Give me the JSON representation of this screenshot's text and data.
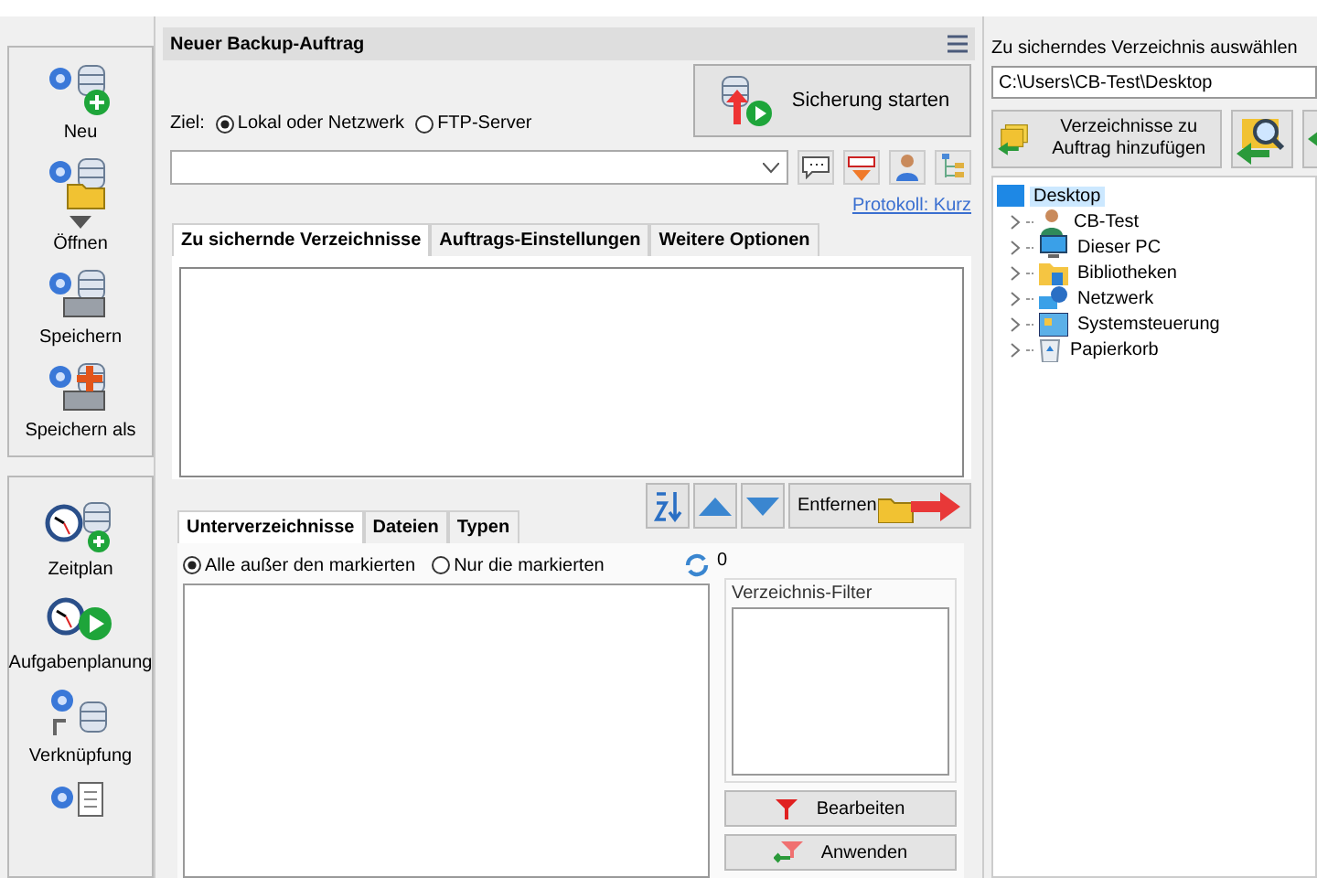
{
  "sidebar": {
    "groups": [
      {
        "items": [
          {
            "label": "Neu",
            "kind": "new"
          },
          {
            "label": "Öffnen",
            "kind": "open"
          },
          {
            "label": "Speichern",
            "kind": "save"
          },
          {
            "label": "Speichern als",
            "kind": "saveas"
          }
        ]
      },
      {
        "items": [
          {
            "label": "Zeitplan",
            "kind": "schedule"
          },
          {
            "label": "Aufgabenplanung",
            "kind": "task"
          },
          {
            "label": "Verknüpfung",
            "kind": "shortcut"
          },
          {
            "kind": "report"
          }
        ]
      }
    ]
  },
  "job": {
    "title": "Neuer Backup-Auftrag",
    "start_button": "Sicherung starten",
    "target_label": "Ziel:",
    "target_options": [
      {
        "label": "Lokal oder Netzwerk",
        "selected": true
      },
      {
        "label": "FTP-Server",
        "selected": false
      }
    ],
    "log_link": "Protokoll: Kurz",
    "tabs": [
      {
        "label": "Zu sichernde Verzeichnisse",
        "selected": true
      },
      {
        "label": "Auftrags-Einstellungen",
        "selected": false
      },
      {
        "label": "Weitere Optionen",
        "selected": false
      }
    ],
    "remove_button": "Entfernen",
    "subtabs": [
      {
        "label": "Unterverzeichnisse",
        "selected": true
      },
      {
        "label": "Dateien",
        "selected": false
      },
      {
        "label": "Typen",
        "selected": false
      }
    ],
    "filter_modes": [
      {
        "label": "Alle außer den markierten",
        "selected": true
      },
      {
        "label": "Nur die markierten",
        "selected": false
      }
    ],
    "count": "0",
    "filter_title": "Verzeichnis-Filter",
    "edit_button": "Bearbeiten",
    "apply_button": "Anwenden"
  },
  "browser": {
    "title": "Zu sicherndes Verzeichnis auswählen",
    "path": "C:\\Users\\CB-Test\\Desktop",
    "add_button": "Verzeichnisse zu Auftrag hinzufügen",
    "tree": [
      {
        "label": "Desktop",
        "kind": "desktop",
        "selected": true,
        "expanded": true,
        "children": [
          {
            "label": "CB-Test",
            "kind": "user",
            "selected": false,
            "expanded": false
          },
          {
            "label": "Dieser PC",
            "kind": "pc",
            "selected": false,
            "expanded": false
          },
          {
            "label": "Bibliotheken",
            "kind": "library",
            "selected": false,
            "expanded": false
          },
          {
            "label": "Netzwerk",
            "kind": "network",
            "selected": false,
            "expanded": false
          },
          {
            "label": "Systemsteuerung",
            "kind": "control",
            "selected": false,
            "expanded": false
          },
          {
            "label": "Papierkorb",
            "kind": "trash",
            "selected": false,
            "expanded": false
          }
        ]
      }
    ]
  }
}
